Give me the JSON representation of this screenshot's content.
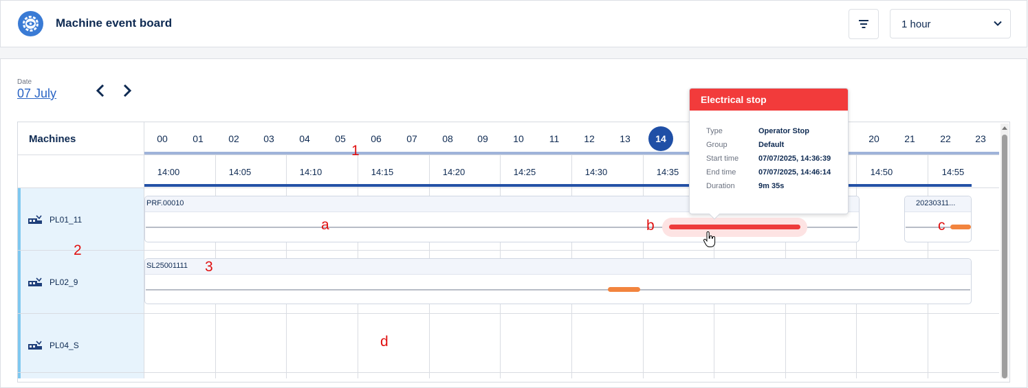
{
  "header": {
    "title": "Machine event board",
    "range_value": "1 hour",
    "icons": {
      "app": "gear-eye-icon",
      "filter": "filter-icon",
      "dropdown": "chevron-down-icon"
    }
  },
  "date_nav": {
    "label": "Date",
    "value": "07 July",
    "icons": {
      "prev": "chevron-left-icon",
      "next": "chevron-right-icon"
    }
  },
  "timeline": {
    "machines_header": "Machines",
    "hours": [
      "00",
      "01",
      "02",
      "03",
      "04",
      "05",
      "06",
      "07",
      "08",
      "09",
      "10",
      "11",
      "12",
      "13",
      "14",
      "20",
      "21",
      "22",
      "23"
    ],
    "active_hour": "14",
    "minutes": [
      "14:00",
      "14:05",
      "14:10",
      "14:15",
      "14:20",
      "14:25",
      "14:30",
      "14:35",
      "14:50",
      "14:55"
    ]
  },
  "machines": [
    {
      "name": "PL01_11",
      "orders": [
        "PRF.00010",
        "20230311..."
      ]
    },
    {
      "name": "PL02_9",
      "orders": [
        "SL25001111"
      ]
    },
    {
      "name": "PL04_S",
      "orders": []
    }
  ],
  "tooltip": {
    "title": "Electrical stop",
    "fields": [
      {
        "key": "Type",
        "value": "Operator Stop"
      },
      {
        "key": "Group",
        "value": "Default"
      },
      {
        "key": "Start time",
        "value": "07/07/2025, 14:36:39"
      },
      {
        "key": "End time",
        "value": "07/07/2025, 14:46:14"
      },
      {
        "key": "Duration",
        "value": "9m 35s"
      }
    ]
  },
  "annotations": {
    "n1": "1",
    "n2": "2",
    "n3": "3",
    "a": "a",
    "b": "b",
    "c": "c",
    "d": "d"
  },
  "colors": {
    "accent": "#1f4fa6",
    "stop": "#f23b3b",
    "event": "#f2843e",
    "machine_row": "#e7f3fc"
  }
}
